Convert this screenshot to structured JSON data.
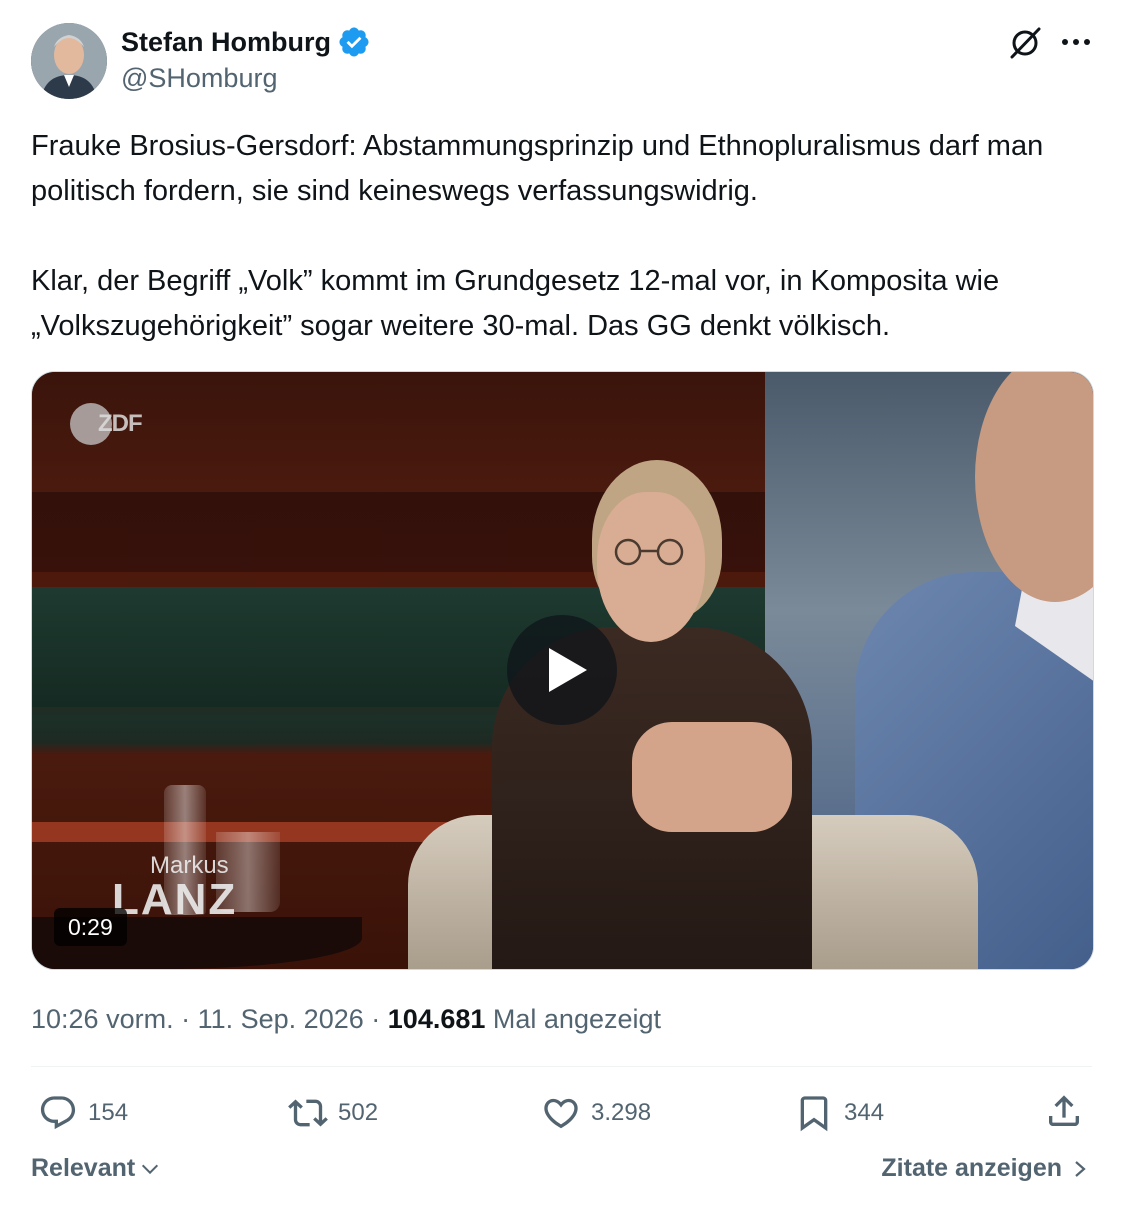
{
  "author": {
    "display_name": "Stefan Homburg",
    "handle": "@SHomburg",
    "verified": true,
    "verified_color": "#1d9bf0"
  },
  "tweet": {
    "text": "Frauke Brosius-Gersdorf: Abstammungsprinzip und Ethnopluralismus darf man politisch fordern, sie sind keineswegs verfassungswidrig.\n\nKlar, der Begriff „Volk” kommt im Grundgesetz 12-mal vor, in Komposita wie „Volkszugehörigkeit” sogar weitere 30-mal. Das GG denkt völkisch."
  },
  "media": {
    "type": "video",
    "duration": "0:29",
    "channel_logo_text": "ZDF",
    "show_title_small": "Markus",
    "show_title_big": "LANZ"
  },
  "meta": {
    "time": "10:26 vorm.",
    "separator": "·",
    "date": "11. Sep. 2026",
    "views_count": "104.681",
    "views_label": "Mal angezeigt"
  },
  "actions": {
    "replies": "154",
    "reposts": "502",
    "likes": "3.298",
    "bookmarks": "344"
  },
  "footer": {
    "sort_label": "Relevant",
    "quotes_label": "Zitate anzeigen"
  },
  "icons": {
    "grok": "grok-icon",
    "more": "more-icon",
    "reply": "reply-icon",
    "repost": "repost-icon",
    "like": "heart-icon",
    "bookmark": "bookmark-icon",
    "share": "share-icon",
    "play": "play-icon"
  },
  "colors": {
    "text": "#0f1419",
    "secondary": "#536471",
    "divider": "#eff3f4"
  }
}
